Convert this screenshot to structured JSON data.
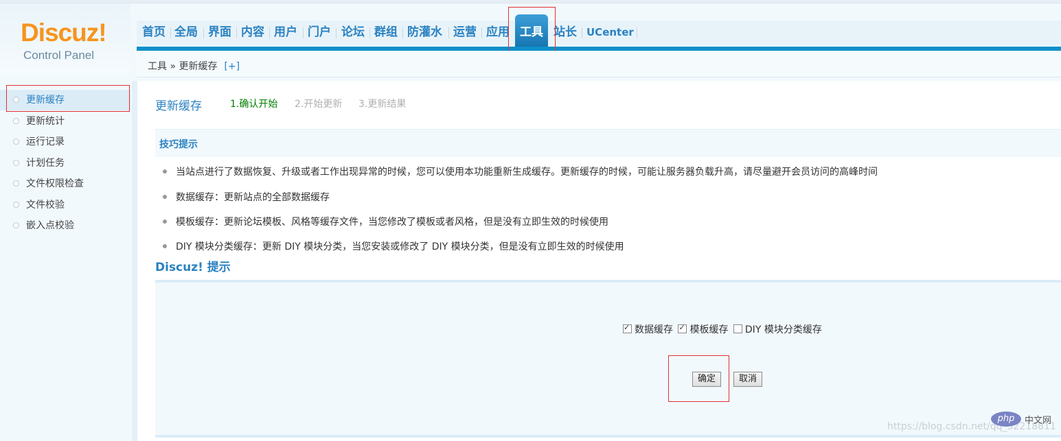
{
  "logo": {
    "main": "Discuz!",
    "sub": "Control Panel"
  },
  "nav": {
    "items": [
      "首页",
      "全局",
      "界面",
      "内容",
      "用户",
      "门户",
      "论坛",
      "群组",
      "防灌水",
      "运营",
      "应用",
      "工具",
      "站长",
      "UCenter"
    ],
    "active": "工具"
  },
  "breadcrumb": {
    "text": "工具 » 更新缓存",
    "toggle": "[+]"
  },
  "sidebar": {
    "items": [
      "更新缓存",
      "更新统计",
      "运行记录",
      "计划任务",
      "文件权限检查",
      "文件校验",
      "嵌入点校验"
    ],
    "active": "更新缓存"
  },
  "main": {
    "title": "更新缓存",
    "steps": [
      "1.确认开始",
      "2.开始更新",
      "3.更新结果"
    ],
    "current_step_color": "#008000",
    "inactive_step_color": "#b0b0b0",
    "tips_title": "技巧提示",
    "tips": [
      "当站点进行了数据恢复、升级或者工作出现异常的时候，您可以使用本功能重新生成缓存。更新缓存的时候，可能让服务器负载升高，请尽量避开会员访问的高峰时间",
      "数据缓存：更新站点的全部数据缓存",
      "模板缓存：更新论坛模板、风格等缓存文件，当您修改了模板或者风格，但是没有立即生效的时候使用",
      "DIY 模块分类缓存：更新 DIY 模块分类，当您安装或修改了 DIY 模块分类，但是没有立即生效的时候使用"
    ],
    "notice_title": "Discuz! 提示",
    "options": [
      {
        "label": "数据缓存",
        "checked": true
      },
      {
        "label": "模板缓存",
        "checked": true
      },
      {
        "label": "DIY 模块分类缓存",
        "checked": false
      }
    ],
    "confirm_label": "确定",
    "cancel_label": "取消"
  },
  "watermark": {
    "url": "https://blog.csdn.net/qq_32218811",
    "php": "php",
    "site": "中文网"
  },
  "colors": {
    "accent": "#2b82c2",
    "nav_bar": "#0e90c8",
    "logo": "#f7941d",
    "highlight_box": "#e03030"
  }
}
